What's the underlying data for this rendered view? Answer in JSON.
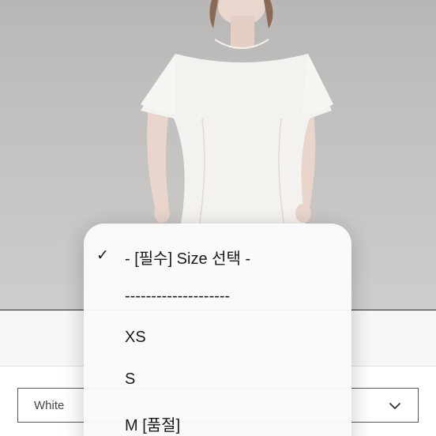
{
  "dropdown": {
    "options": [
      {
        "label": "- [필수] Size 선택 -",
        "selected": true
      },
      {
        "label": "--------------------",
        "selected": false
      },
      {
        "label": "XS",
        "selected": false
      },
      {
        "label": "S",
        "selected": false
      },
      {
        "label": "M [품절]",
        "selected": false
      }
    ],
    "check_glyph": "✓"
  },
  "color_select": {
    "value": "White",
    "icon": "chevron-down-icon"
  },
  "product_image": {
    "subject": "model wearing white short-sleeve dress"
  }
}
